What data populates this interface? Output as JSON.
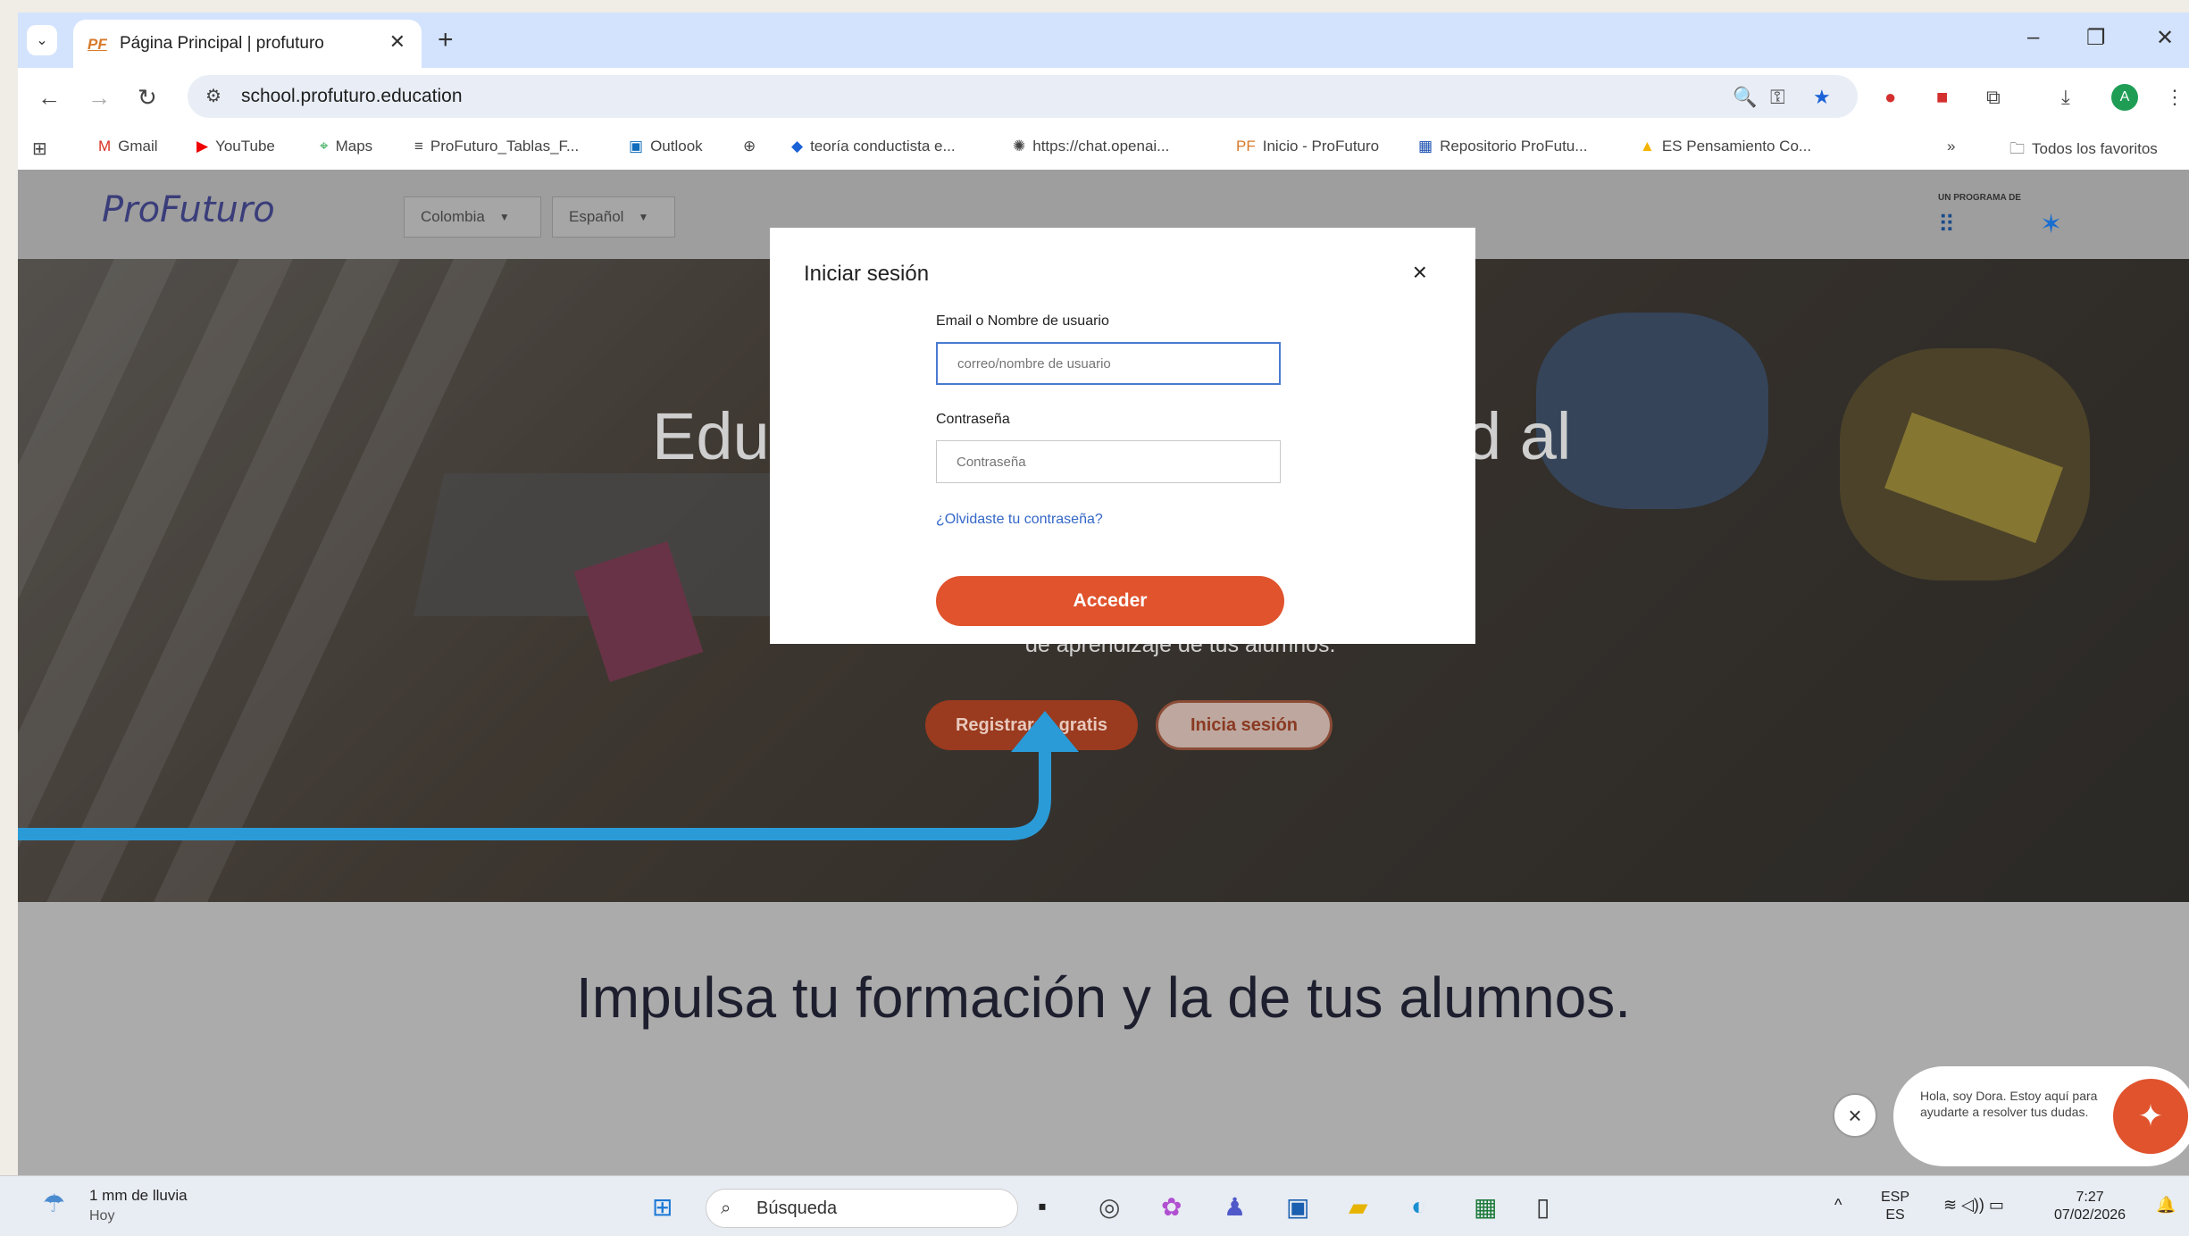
{
  "browser": {
    "tab_title": "Página Principal | profuturo",
    "tab_favicon": "PF",
    "url": "school.profuturo.education",
    "bookmarks": [
      "Gmail",
      "YouTube",
      "Maps",
      "ProFuturo_Tablas_F...",
      "Outlook",
      "teoría conductista e...",
      "https://chat.openai...",
      "Inicio - ProFuturo",
      "Repositorio ProFutu...",
      "ES Pensamiento Co..."
    ],
    "all_bookmarks": "Todos los favoritos",
    "more": "»"
  },
  "site": {
    "logo": "ProFuturo",
    "country": "Colombia",
    "language": "Español",
    "program_label": "UN PROGRAMA DE",
    "hero_title_left": "Edu",
    "hero_title_right": "d al",
    "hero_subtitle": "de aprendizaje de tus alumnos.",
    "register_button": "Registrarse gratis",
    "login_button": "Inicia sesión",
    "section_title": "Impulsa tu formación y la de tus alumnos."
  },
  "modal": {
    "title": "Iniciar sesión",
    "close": "×",
    "email_label": "Email o Nombre de usuario",
    "email_placeholder": "correo/nombre de usuario",
    "password_label": "Contraseña",
    "password_placeholder": "Contraseña",
    "forgot_link": "¿Olvidaste tu contraseña?",
    "submit": "Acceder"
  },
  "chat": {
    "message": "Hola, soy Dora. Estoy aquí para ayudarte a resolver tus dudas.",
    "close": "×"
  },
  "taskbar": {
    "weather_temp": "1 mm de lluvia",
    "weather_sub": "Hoy",
    "search": "Búsqueda",
    "lang_top": "ESP",
    "lang_bottom": "ES",
    "time": "7:27",
    "date": "07/02/2026"
  },
  "colors": {
    "accent": "#e0532d",
    "arrow": "#2b9bd8",
    "link": "#3467c7"
  }
}
